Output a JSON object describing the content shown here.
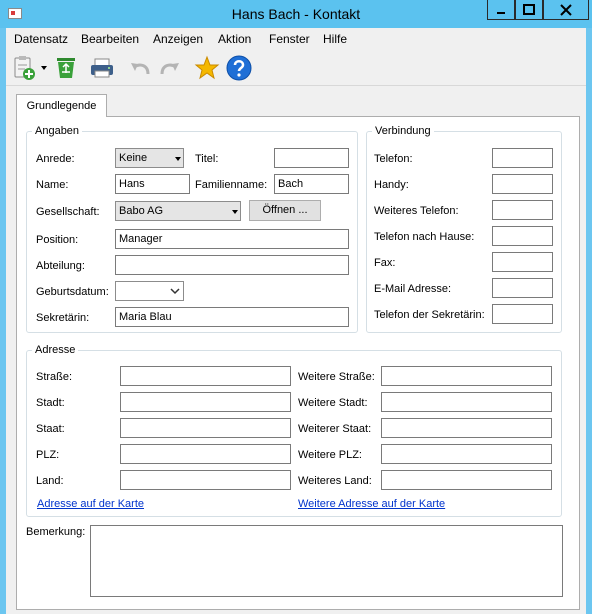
{
  "window": {
    "title": "Hans Bach - Kontakt"
  },
  "menu": [
    "Datensatz",
    "Bearbeiten",
    "Anzeigen",
    "Aktion",
    "Fenster",
    "Hilfe"
  ],
  "tab": "Grundlegende",
  "angaben": {
    "legend": "Angaben",
    "anrede_label": "Anrede:",
    "anrede_value": "Keine",
    "titel_label": "Titel:",
    "titel_value": "",
    "name_label": "Name:",
    "name_value": "Hans",
    "familienname_label": "Familienname:",
    "familienname_value": "Bach",
    "gesellschaft_label": "Gesellschaft:",
    "gesellschaft_value": "Babo AG",
    "oeffnen_label": "Öffnen ...",
    "position_label": "Position:",
    "position_value": "Manager",
    "abteilung_label": "Abteilung:",
    "abteilung_value": "",
    "geburtsdatum_label": "Geburtsdatum:",
    "geburtsdatum_value": "",
    "sekretaerin_label": "Sekretärin:",
    "sekretaerin_value": "Maria Blau"
  },
  "verbindung": {
    "legend": "Verbindung",
    "fields": [
      {
        "label": "Telefon:",
        "value": ""
      },
      {
        "label": "Handy:",
        "value": ""
      },
      {
        "label": "Weiteres Telefon:",
        "value": ""
      },
      {
        "label": "Telefon nach Hause:",
        "value": ""
      },
      {
        "label": "Fax:",
        "value": ""
      },
      {
        "label": "E-Mail Adresse:",
        "value": ""
      },
      {
        "label": "Telefon der Sekretärin:",
        "value": ""
      }
    ]
  },
  "adresse": {
    "legend": "Adresse",
    "left": [
      {
        "label": "Straße:",
        "value": ""
      },
      {
        "label": "Stadt:",
        "value": ""
      },
      {
        "label": "Staat:",
        "value": ""
      },
      {
        "label": "PLZ:",
        "value": ""
      },
      {
        "label": "Land:",
        "value": ""
      }
    ],
    "right": [
      {
        "label": "Weitere Straße:",
        "value": ""
      },
      {
        "label": "Weitere Stadt:",
        "value": ""
      },
      {
        "label": "Weiterer Staat:",
        "value": ""
      },
      {
        "label": "Weitere PLZ:",
        "value": ""
      },
      {
        "label": "Weiteres Land:",
        "value": ""
      }
    ],
    "map_link": "Adresse auf der Karte",
    "map_link_2": "Weitere Adresse auf der Karte"
  },
  "bemerkung": {
    "label": "Bemerkung:",
    "value": ""
  },
  "toolbar": {
    "icons": [
      "new-contact-icon",
      "dropdown-arrow-icon",
      "recycle-bin-icon",
      "print-icon",
      "undo-icon",
      "redo-icon",
      "favorite-star-icon",
      "help-icon"
    ]
  },
  "colors": {
    "titlebar": "#5bc2ef",
    "link": "#0033cc",
    "star": "#f5b800",
    "help": "#1f6fd6",
    "recycle": "#3aa13a"
  }
}
